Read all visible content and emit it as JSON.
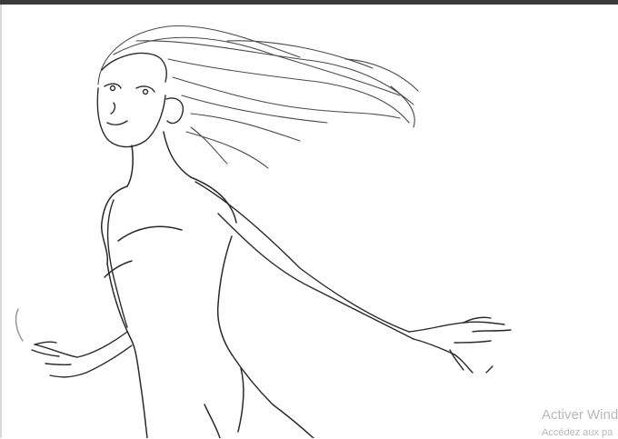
{
  "window": {
    "topbar_color": "#3b3b3b"
  },
  "canvas": {
    "background": "#ffffff",
    "stroke_color": "#2a2a2a",
    "subject": "pencil-sketch-figure"
  },
  "watermark": {
    "title": "Activer Wind",
    "subtitle": "Accédez aux pa",
    "color": "#b9b9b9"
  }
}
